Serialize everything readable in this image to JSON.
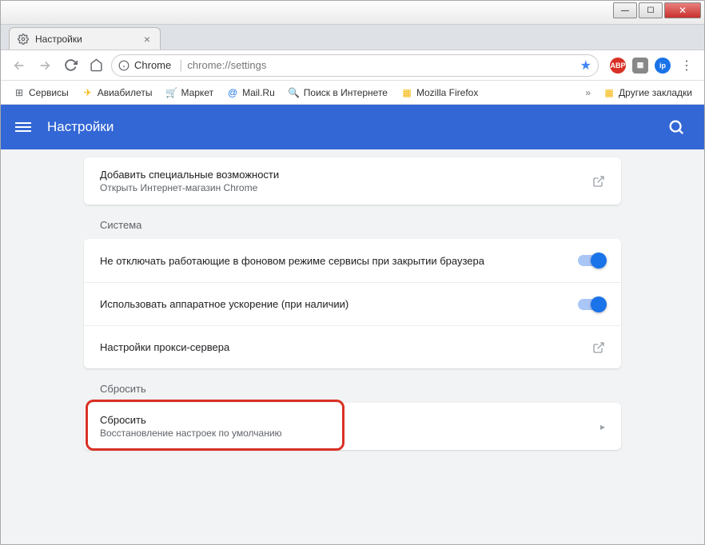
{
  "window_controls": {
    "min": "—",
    "max": "☐",
    "close": "✕"
  },
  "tab": {
    "title": "Настройки",
    "close": "×"
  },
  "nav": {
    "origin_label": "Chrome",
    "url": "chrome://settings"
  },
  "bookmarks": {
    "items": [
      {
        "icon": "⊞",
        "label": "Сервисы",
        "color": "#5f6368"
      },
      {
        "icon": "✈",
        "label": "Авиабилеты",
        "color": "#f5b400"
      },
      {
        "icon": "🛒",
        "label": "Маркет",
        "color": "#f5b400"
      },
      {
        "icon": "@",
        "label": "Mail.Ru",
        "color": "#1a73e8"
      },
      {
        "icon": "🔍",
        "label": "Поиск в Интернете",
        "color": "#f5b400"
      },
      {
        "icon": "▦",
        "label": "Mozilla Firefox",
        "color": "#f5b400"
      }
    ],
    "overflow": "»",
    "other": {
      "icon": "▦",
      "label": "Другие закладки"
    }
  },
  "header": {
    "title": "Настройки"
  },
  "accessibility_card": {
    "title": "Добавить специальные возможности",
    "subtitle": "Открыть Интернет-магазин Chrome"
  },
  "sections": {
    "system": {
      "heading": "Система",
      "rows": [
        {
          "title": "Не отключать работающие в фоновом режиме сервисы при закрытии браузера"
        },
        {
          "title": "Использовать аппаратное ускорение (при наличии)"
        },
        {
          "title": "Настройки прокси-сервера"
        }
      ]
    },
    "reset": {
      "heading": "Сбросить",
      "rows": [
        {
          "title": "Сбросить",
          "subtitle": "Восстановление настроек по умолчанию"
        }
      ]
    }
  }
}
